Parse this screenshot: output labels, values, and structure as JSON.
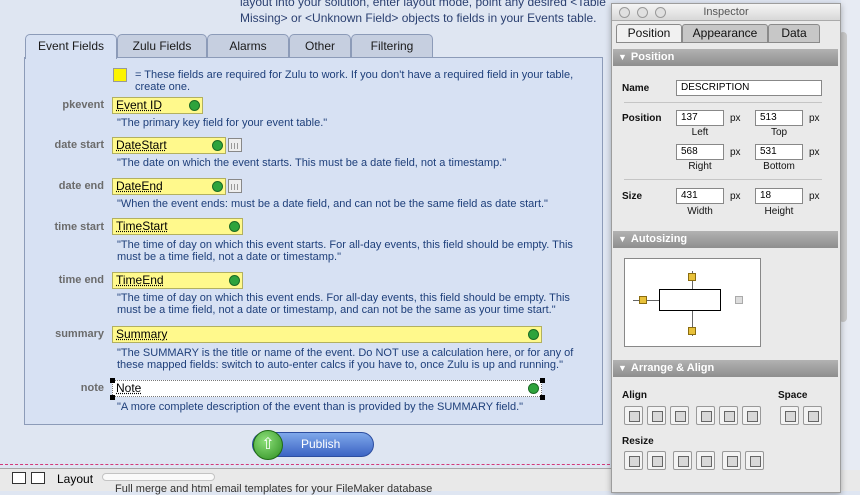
{
  "doc": {
    "line1": "layout into your solution, enter layout mode, point any desired <Table",
    "line2": "Missing> or <Unknown Field> objects to fields in your Events table."
  },
  "tabs": [
    {
      "label": "Event Fields"
    },
    {
      "label": "Zulu Fields"
    },
    {
      "label": "Alarms"
    },
    {
      "label": "Other"
    },
    {
      "label": "Filtering"
    }
  ],
  "required_note": "= These fields are required for Zulu to work. If you don't have a required field in your table, create one.",
  "fields": [
    {
      "label": "pkevent",
      "value": "Event ID",
      "desc": "\"The primary key field for your event table.\""
    },
    {
      "label": "date start",
      "value": "DateStart",
      "desc": "\"The date on which the event starts.  This must be a date field, not a timestamp.\""
    },
    {
      "label": "date end",
      "value": "DateEnd",
      "desc": "\"When the event ends: must be a date field, and can not be the same field as date start.\""
    },
    {
      "label": "time start",
      "value": "TimeStart",
      "desc": "\"The time of day on which this event starts.  For all-day events, this field should be empty.  This must be a time field, not a date or timestamp.\""
    },
    {
      "label": "time end",
      "value": "TimeEnd",
      "desc": "\"The time of day on which this event ends.  For all-day events, this field should be empty. This must be a time field, not a date or timestamp, and can not be the same as your time start.\""
    },
    {
      "label": "summary",
      "value": "Summary",
      "desc": "\"The SUMMARY is the title or name of the event. Do NOT use a calculation here, or for any of these mapped fields: switch to auto-enter calcs if you have to, once Zulu is up and running.\""
    },
    {
      "label": "note",
      "value": "Note",
      "desc": "\"A more complete description of the event than is provided by the SUMMARY field.\""
    }
  ],
  "publish_label": "Publish",
  "statusbar": {
    "mode": "Layout",
    "partial": "Full merge and html email templates for your FileMaker database"
  },
  "inspector": {
    "title": "Inspector",
    "tabs": [
      "Position",
      "Appearance",
      "Data"
    ],
    "position_header": "Position",
    "name_label": "Name",
    "name_value": "DESCRIPTION",
    "position_label": "Position",
    "left": "137",
    "top": "513",
    "right": "568",
    "bottom": "531",
    "left_label": "Left",
    "top_label": "Top",
    "right_label": "Right",
    "bottom_label": "Bottom",
    "size_label": "Size",
    "width": "431",
    "height": "18",
    "width_label": "Width",
    "height_label": "Height",
    "unit": "px",
    "autosizing_header": "Autosizing",
    "arrange_header": "Arrange & Align",
    "align_label": "Align",
    "space_label": "Space",
    "resize_label": "Resize"
  },
  "colors": {
    "required_yellow": "#fcf402",
    "field_yellow": "#fff98c",
    "publish_blue": "#3c64c4"
  }
}
